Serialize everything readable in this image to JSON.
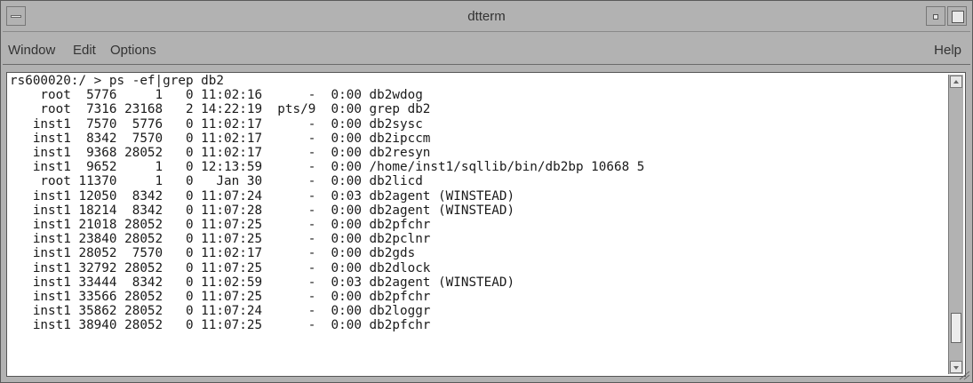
{
  "window": {
    "title": "dtterm"
  },
  "menubar": {
    "window_label": "Window",
    "edit_label": "Edit",
    "options_label": "Options",
    "help_label": "Help"
  },
  "terminal": {
    "prompt": "rs600020:/ > ps -ef|grep db2",
    "rows": [
      "    root  5776     1   0 11:02:16      -  0:00 db2wdog",
      "    root  7316 23168   2 14:22:19  pts/9  0:00 grep db2",
      "   inst1  7570  5776   0 11:02:17      -  0:00 db2sysc",
      "   inst1  8342  7570   0 11:02:17      -  0:00 db2ipccm",
      "   inst1  9368 28052   0 11:02:17      -  0:00 db2resyn",
      "   inst1  9652     1   0 12:13:59      -  0:00 /home/inst1/sqllib/bin/db2bp 10668 5",
      "    root 11370     1   0   Jan 30      -  0:00 db2licd",
      "   inst1 12050  8342   0 11:07:24      -  0:03 db2agent (WINSTEAD)",
      "   inst1 18214  8342   0 11:07:28      -  0:00 db2agent (WINSTEAD)",
      "   inst1 21018 28052   0 11:07:25      -  0:00 db2pfchr",
      "   inst1 23840 28052   0 11:07:25      -  0:00 db2pclnr",
      "   inst1 28052  7570   0 11:02:17      -  0:00 db2gds",
      "   inst1 32792 28052   0 11:07:25      -  0:00 db2dlock",
      "   inst1 33444  8342   0 11:02:59      -  0:03 db2agent (WINSTEAD)",
      "   inst1 33566 28052   0 11:07:25      -  0:00 db2pfchr",
      "   inst1 35862 28052   0 11:07:24      -  0:00 db2loggr",
      "   inst1 38940 28052   0 11:07:25      -  0:00 db2pfchr"
    ]
  },
  "colors": {
    "dither_light": "#d2d2d2",
    "dither_dark": "#8c8c8c",
    "terminal_background": "#ffffff",
    "terminal_text": "#1a1a1a"
  }
}
